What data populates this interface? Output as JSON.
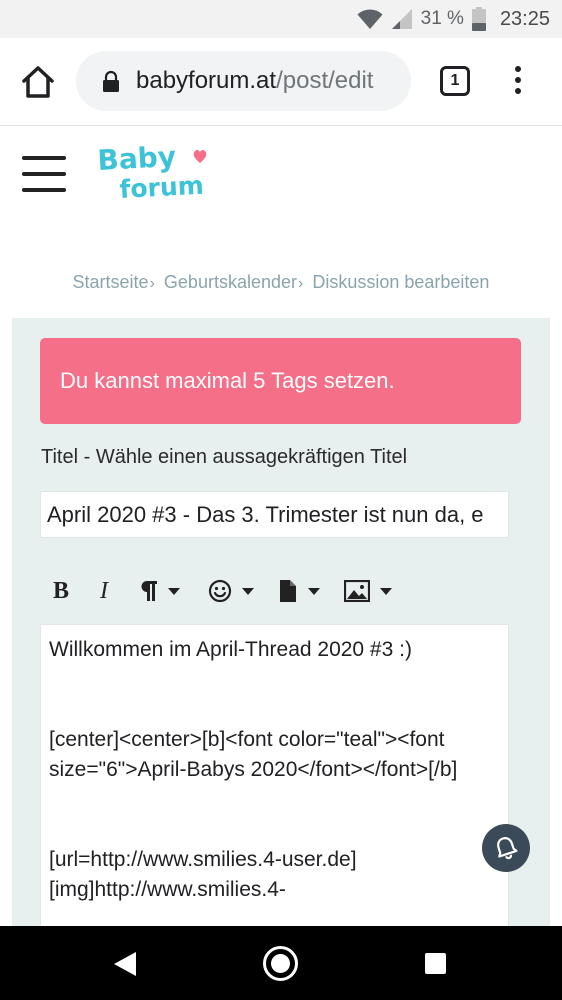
{
  "status_bar": {
    "battery": "31 %",
    "time": "23:25"
  },
  "browser": {
    "url_host": "babyforum.at",
    "url_path": "/post/edit",
    "tab_count": "1"
  },
  "site": {
    "logo_text_top": "Baby",
    "logo_text_bottom": "forum"
  },
  "breadcrumb": {
    "items": [
      "Startseite",
      "Geburtskalender",
      "Diskussion bearbeiten"
    ],
    "separator": "›"
  },
  "alert": {
    "message": "Du kannst maximal 5 Tags setzen."
  },
  "form": {
    "title_label": "Titel - Wähle einen aussagekräftigen Titel",
    "title_value": "April 2020 #3 - Das 3. Trimester ist nun da, e"
  },
  "toolbar": {
    "bold_label": "B",
    "italic_label": "I",
    "icons": [
      "paragraph-icon",
      "smiley-icon",
      "file-icon",
      "image-icon"
    ]
  },
  "editor": {
    "line1": "Willkommen im April-Thread 2020 #3 :)",
    "line2": "[center]<center>[b]<font color=\"teal\"><font size=\"6\">April-Babys 2020</font></font>[/b]",
    "line3": "[url=http://www.smilies.4-user.de][img]http://www.smilies.4-"
  },
  "colors": {
    "alert_bg": "#f46f87",
    "panel_bg": "#e8efef",
    "logo_teal": "#3cc3d8",
    "logo_heart": "#f46f87",
    "breadcrumb": "#8aa3ad"
  }
}
